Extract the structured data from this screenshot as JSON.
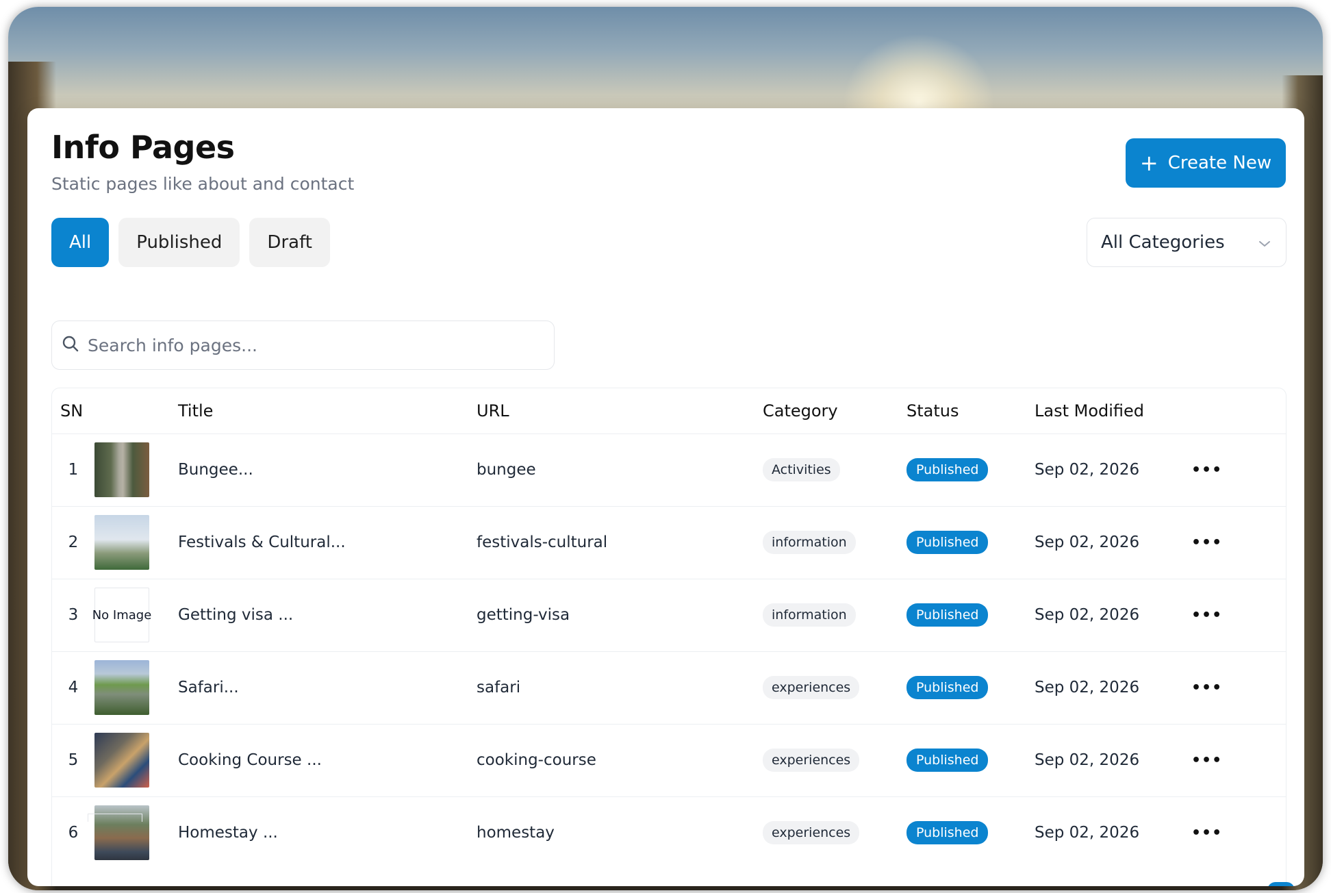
{
  "header": {
    "title": "Info Pages",
    "subtitle": "Static pages like about and contact",
    "create_label": "Create New"
  },
  "filters": {
    "all": "All",
    "published": "Published",
    "draft": "Draft",
    "active": "All"
  },
  "category_select": {
    "selected": "All Categories"
  },
  "search": {
    "placeholder": "Search info pages..."
  },
  "table": {
    "columns": {
      "sn": "SN",
      "title": "Title",
      "url": "URL",
      "category": "Category",
      "status": "Status",
      "last_modified": "Last Modified"
    },
    "no_image_label": "No Image",
    "rows": [
      {
        "sn": "1",
        "title": "Bungee...",
        "url": "bungee",
        "category": "Activities",
        "status": "Published",
        "modified": "Sep 02, 2026",
        "image": "gorge"
      },
      {
        "sn": "2",
        "title": "Festivals & Cultural...",
        "url": "festivals-cultural",
        "category": "information",
        "status": "Published",
        "modified": "Sep 02, 2026",
        "image": "swing"
      },
      {
        "sn": "3",
        "title": "Getting visa ...",
        "url": "getting-visa",
        "category": "information",
        "status": "Published",
        "modified": "Sep 02, 2026",
        "image": "none"
      },
      {
        "sn": "4",
        "title": "Safari...",
        "url": "safari",
        "category": "experiences",
        "status": "Published",
        "modified": "Sep 02, 2026",
        "image": "grassland"
      },
      {
        "sn": "5",
        "title": "Cooking Course ...",
        "url": "cooking-course",
        "category": "experiences",
        "status": "Published",
        "modified": "Sep 02, 2026",
        "image": "kitchen"
      },
      {
        "sn": "6",
        "title": "Homestay ...",
        "url": "homestay",
        "category": "experiences",
        "status": "Published",
        "modified": "Sep 02, 2026",
        "image": "village"
      }
    ]
  },
  "colors": {
    "accent": "#0b84cf",
    "badge_bg": "#f1f2f4",
    "muted_text": "#6b7280"
  },
  "icons": {
    "create": "plus-icon",
    "select": "chevron-down-icon",
    "search": "search-icon",
    "row_actions": "more-horizontal-icon"
  }
}
